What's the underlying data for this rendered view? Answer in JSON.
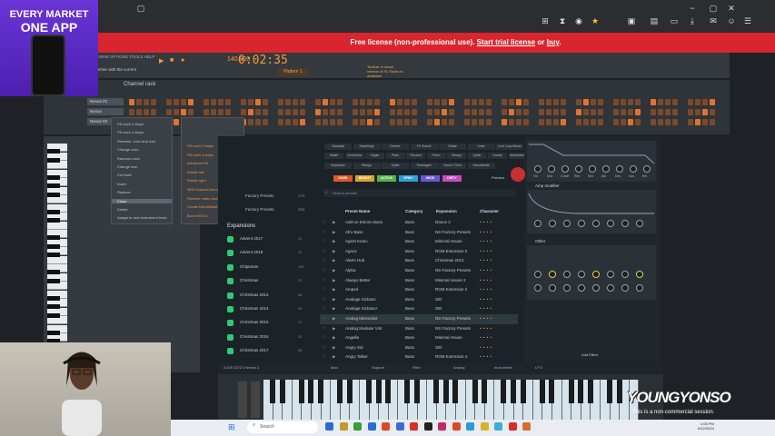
{
  "ad": {
    "line1": "EVERY MARKET",
    "line2": "ONE APP"
  },
  "browser": {
    "tab_fragment": "23",
    "banner_pre": "Free license (non-professional use). ",
    "banner_link1": "Start trial license",
    "banner_mid": " or ",
    "banner_link2": "buy",
    "banner_post": "."
  },
  "toolbar": {
    "menu": "VIEW  OPTIONS  TOOLS  HELP",
    "sub": "tcher with the current",
    "tempo": "140.000",
    "time": "0:02:35",
    "pattern": "Pattern 1",
    "hint": "Toolbar: A newer version of FL Studio is available"
  },
  "rack": {
    "title": "Channel rack",
    "channels": [
      "Nexus #2",
      "Nexus",
      "Nexus #3"
    ]
  },
  "context_menu": {
    "left": [
      "Fill each 2 steps",
      "Fill each 4 steps",
      "Rename, color and icon",
      "Change color",
      "Random color",
      "Change icon",
      "Cut itself",
      "Insert",
      "Replace",
      "Clone",
      "Delete",
      "Assign to new instrument track"
    ],
    "right": [
      "Fill each 2 steps",
      "Fill each 4 steps",
      "Advanced fill",
      "Rotate left",
      "Rotate right",
      "MIDI channel through",
      "Receive notes from",
      "Create DirectWave instrument",
      "Burn MIDI to"
    ]
  },
  "sidebar": {
    "items": [
      "Factory Presets",
      "Factory Presets"
    ],
    "counts": [
      "174",
      "324"
    ],
    "expansions_label": "Expansions",
    "expansions": [
      {
        "name": "Advent 2017",
        "count": "22"
      },
      {
        "name": "Advent 2018",
        "count": "22"
      },
      {
        "name": "Chiptunes",
        "count": "109"
      },
      {
        "name": "Christmas",
        "count": "23"
      },
      {
        "name": "Christmas 2013",
        "count": "64"
      },
      {
        "name": "Christmas 2014",
        "count": "36"
      },
      {
        "name": "Christmas 2015",
        "count": "37"
      },
      {
        "name": "Christmas 2016",
        "count": "31"
      },
      {
        "name": "Christmas 2017",
        "count": "36"
      }
    ]
  },
  "categories": {
    "row1": [
      "Classical",
      "Sweetings",
      "Drones",
      "FX Sound",
      "Guitar",
      "Lead",
      "Live Loop Music"
    ],
    "row2": [
      "Mallet",
      "Orchestra",
      "Organ",
      "Pads",
      "Plucked",
      "Piano",
      "Strings",
      "Synth",
      "Vocals",
      "Woodwinds"
    ],
    "row3": [
      "Sequence",
      "Strings",
      "Synth",
      "Timbrages",
      "Vocal / Choir",
      "Woodwinds"
    ],
    "tags": [
      "DARK",
      "BRIGHT",
      "ACTIVE",
      "SPIKY",
      "WIDE",
      "DIRTY"
    ],
    "tag_colors": [
      "#d95a2b",
      "#d9a42b",
      "#5bb04a",
      "#2e9fd9",
      "#6a55d9",
      "#c84ac0"
    ],
    "preview": "Preview",
    "search_placeholder": "Search presets"
  },
  "table": {
    "headers": [
      "Preset Name",
      "Category",
      "Expansion",
      "Character"
    ],
    "rows": [
      [
        "Add-on Electro Bass",
        "Bass",
        "Dance 2"
      ],
      [
        "Afro Bass",
        "Bass",
        "NS Factory Presets"
      ],
      [
        "Agent Knarc",
        "Bass",
        "Minimal House"
      ],
      [
        "Agnox",
        "Bass",
        "ROM Extension 2"
      ],
      [
        "Alarm Hub",
        "Bass",
        "Christmas 2013"
      ],
      [
        "Alpha",
        "Bass",
        "NS Factory Presets"
      ],
      [
        "Always Better",
        "Bass",
        "Minimal House 2"
      ],
      [
        "Amped",
        "Bass",
        "ROM Extension 2"
      ],
      [
        "Analoge Sicbass",
        "Bass",
        "SID"
      ],
      [
        "Analoge Sicbass+",
        "Bass",
        "SID"
      ],
      [
        "Analog Minimalist",
        "Bass",
        "NS Factory Presets"
      ],
      [
        "Analog Modular Vint",
        "Bass",
        "NS Factory Presets"
      ],
      [
        "Angella",
        "Bass",
        "Minimal House"
      ],
      [
        "Angry Sid",
        "Bass",
        "SID"
      ],
      [
        "Angry Talker",
        "Bass",
        "ROM Extension 4"
      ]
    ]
  },
  "synth": {
    "amp_label": "Amp modifier",
    "other_label": "Other",
    "add_effect": "Add Effect",
    "knob_labels": [
      "Vol",
      "Dns",
      "Cutoff",
      "Res",
      "Smt",
      "Atk",
      "Dec",
      "Sus",
      "Rel"
    ]
  },
  "bottom": {
    "items": [
      "Mod",
      "Support",
      "Filter",
      "Analog",
      "mod wheel",
      "LFO"
    ],
    "left_info": "0.425  3272.5  Nexus 3"
  },
  "taskbar": {
    "search": "Search",
    "time": "1:05 PM",
    "date": "9/12/2024",
    "icon_colors": [
      "#2a6bd6",
      "#c39b2b",
      "#3a9a3a",
      "#2a6bd6",
      "#d94a2b",
      "#3b6bd6",
      "#d9302b",
      "#222",
      "#c42b6a",
      "#d94a2b",
      "#2a9ad6",
      "#d9b02b",
      "#3ab0d6",
      "#d92b2b",
      "#d96a2b"
    ]
  },
  "watermark": {
    "name": "YOUNGYONSO",
    "notice": "This is a non-commercial session."
  }
}
